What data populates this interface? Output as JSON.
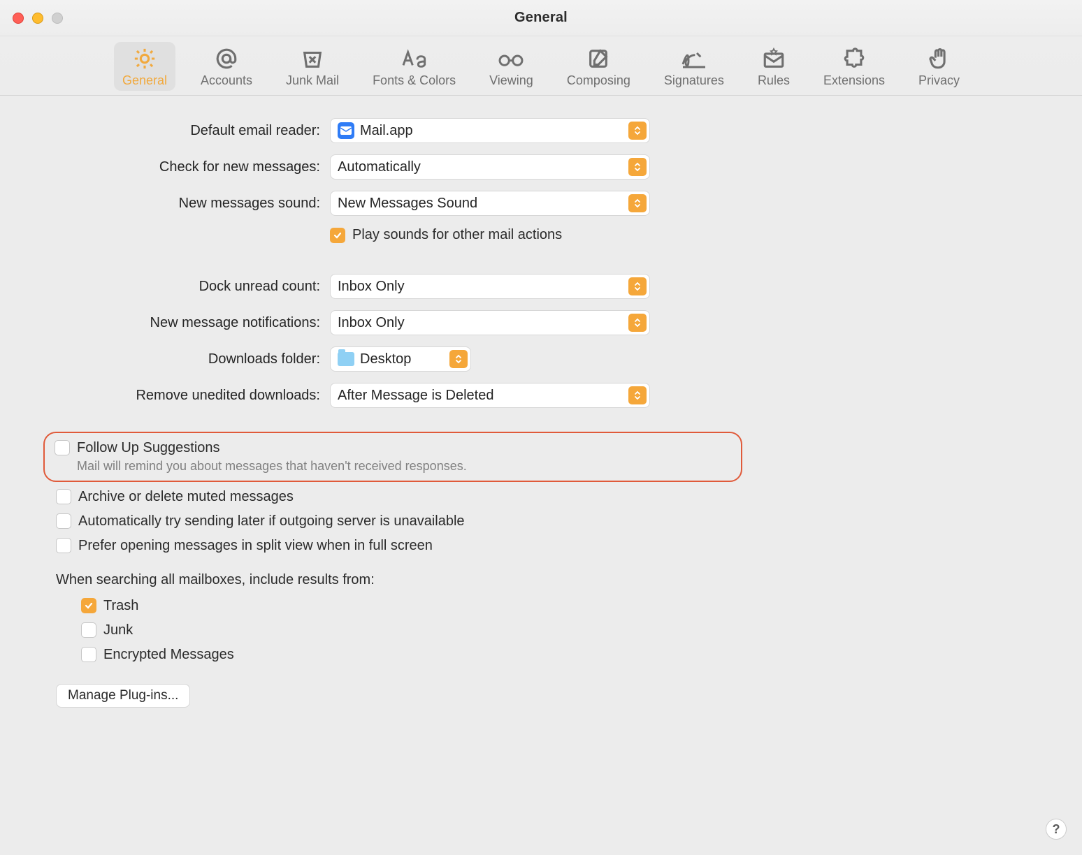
{
  "window": {
    "title": "General"
  },
  "tabs": [
    {
      "label": "General"
    },
    {
      "label": "Accounts"
    },
    {
      "label": "Junk Mail"
    },
    {
      "label": "Fonts & Colors"
    },
    {
      "label": "Viewing"
    },
    {
      "label": "Composing"
    },
    {
      "label": "Signatures"
    },
    {
      "label": "Rules"
    },
    {
      "label": "Extensions"
    },
    {
      "label": "Privacy"
    }
  ],
  "form": {
    "default_reader_label": "Default email reader:",
    "default_reader_value": "Mail.app",
    "check_messages_label": "Check for new messages:",
    "check_messages_value": "Automatically",
    "sound_label": "New messages sound:",
    "sound_value": "New Messages Sound",
    "play_sounds_label": "Play sounds for other mail actions",
    "dock_label": "Dock unread count:",
    "dock_value": "Inbox Only",
    "notif_label": "New message notifications:",
    "notif_value": "Inbox Only",
    "downloads_folder_label": "Downloads folder:",
    "downloads_folder_value": "Desktop",
    "remove_downloads_label": "Remove unedited downloads:",
    "remove_downloads_value": "After Message is Deleted"
  },
  "checks": {
    "follow_up_label": "Follow Up Suggestions",
    "follow_up_sub": "Mail will remind you about messages that haven't received responses.",
    "archive_muted": "Archive or delete muted messages",
    "auto_send": "Automatically try sending later if outgoing server is unavailable",
    "split_view": "Prefer opening messages in split view when in full screen"
  },
  "search": {
    "heading": "When searching all mailboxes, include results from:",
    "trash": "Trash",
    "junk": "Junk",
    "encrypted": "Encrypted Messages"
  },
  "buttons": {
    "manage_plugins": "Manage Plug-ins...",
    "help": "?"
  }
}
